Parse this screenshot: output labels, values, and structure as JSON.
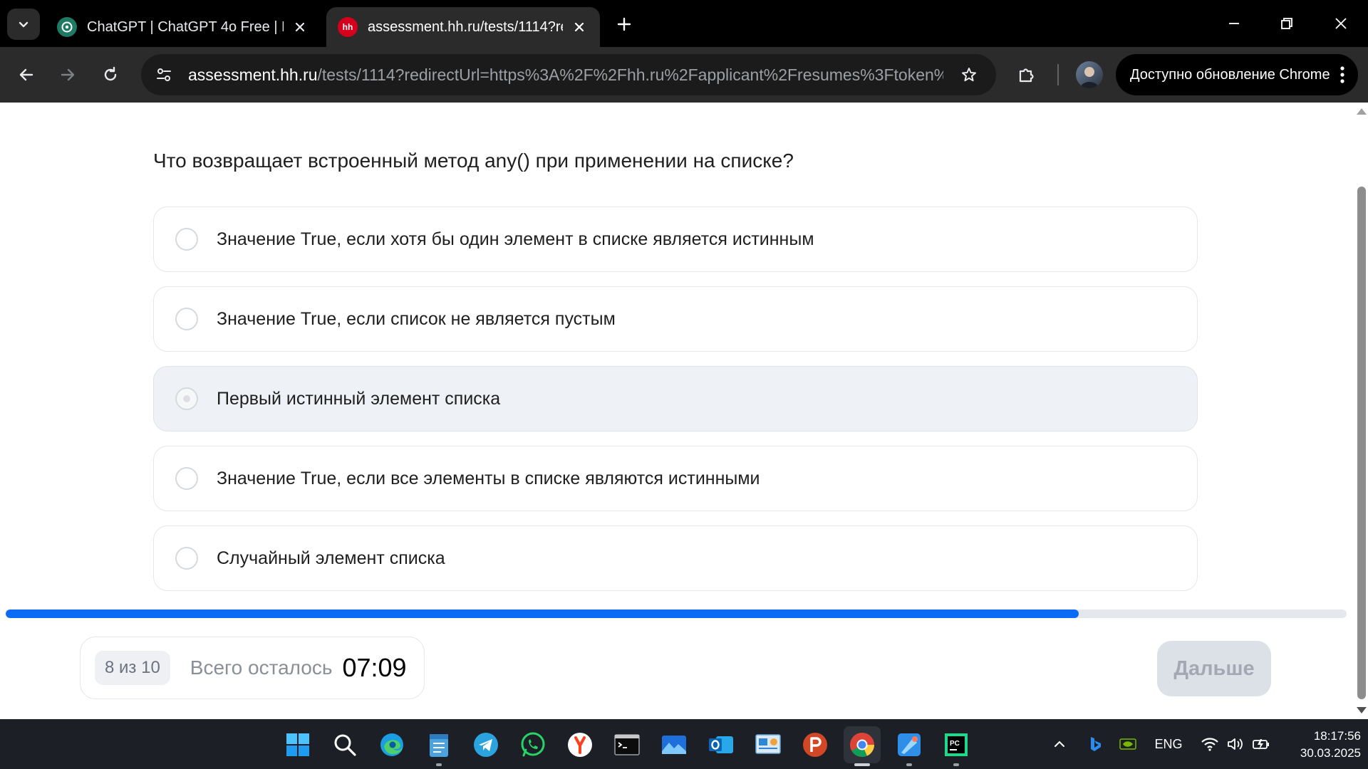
{
  "browser": {
    "tabs": [
      {
        "title": "ChatGPT | ChatGPT 4o Free | По",
        "active": false,
        "favicon": "chatgpt-icon"
      },
      {
        "title": "assessment.hh.ru/tests/1114?re",
        "active": true,
        "favicon": "hh-icon",
        "favicon_text": "hh"
      }
    ],
    "url_host": "assessment.hh.ru",
    "url_rest": "/tests/1114?redirectUrl=https%3A%2F%2Fhh.ru%2Fapplicant%2Fresumes%3Ftoken%...",
    "update_button": "Доступно обновление Chrome"
  },
  "quiz": {
    "question": "Что возвращает встроенный метод any() при применении на списке?",
    "options": [
      {
        "label": "Значение True, если хотя бы один элемент в списке является истинным"
      },
      {
        "label": "Значение True, если список не является пустым"
      },
      {
        "label": "Первый истинный элемент списка"
      },
      {
        "label": "Значение True, если все элементы в списке являются истинными"
      },
      {
        "label": "Случайный элемент списка"
      }
    ],
    "progress_fraction": 0.8,
    "counter": "8 из 10",
    "remaining_label": "Всего осталось",
    "timer": "07:09",
    "next_button": "Дальше"
  },
  "taskbar": {
    "apps": [
      "windows-start-icon",
      "search-icon",
      "edge-icon",
      "notepad-icon",
      "telegram-icon",
      "whatsapp-icon",
      "yandex-browser-icon",
      "terminal-icon",
      "photos-icon",
      "outlook-icon",
      "control-panel-icon",
      "powerpoint-p-icon",
      "chrome-icon",
      "paint-icon",
      "pycharm-icon"
    ],
    "language": "ENG",
    "time": "18:17:56",
    "date": "30.03.2025"
  },
  "colors": {
    "accent": "#0a6cf5",
    "progress_track": "#e4e8ee",
    "hh_red": "#d6001c",
    "tabstrip": "#000000",
    "toolbar": "#2b2b2b"
  }
}
